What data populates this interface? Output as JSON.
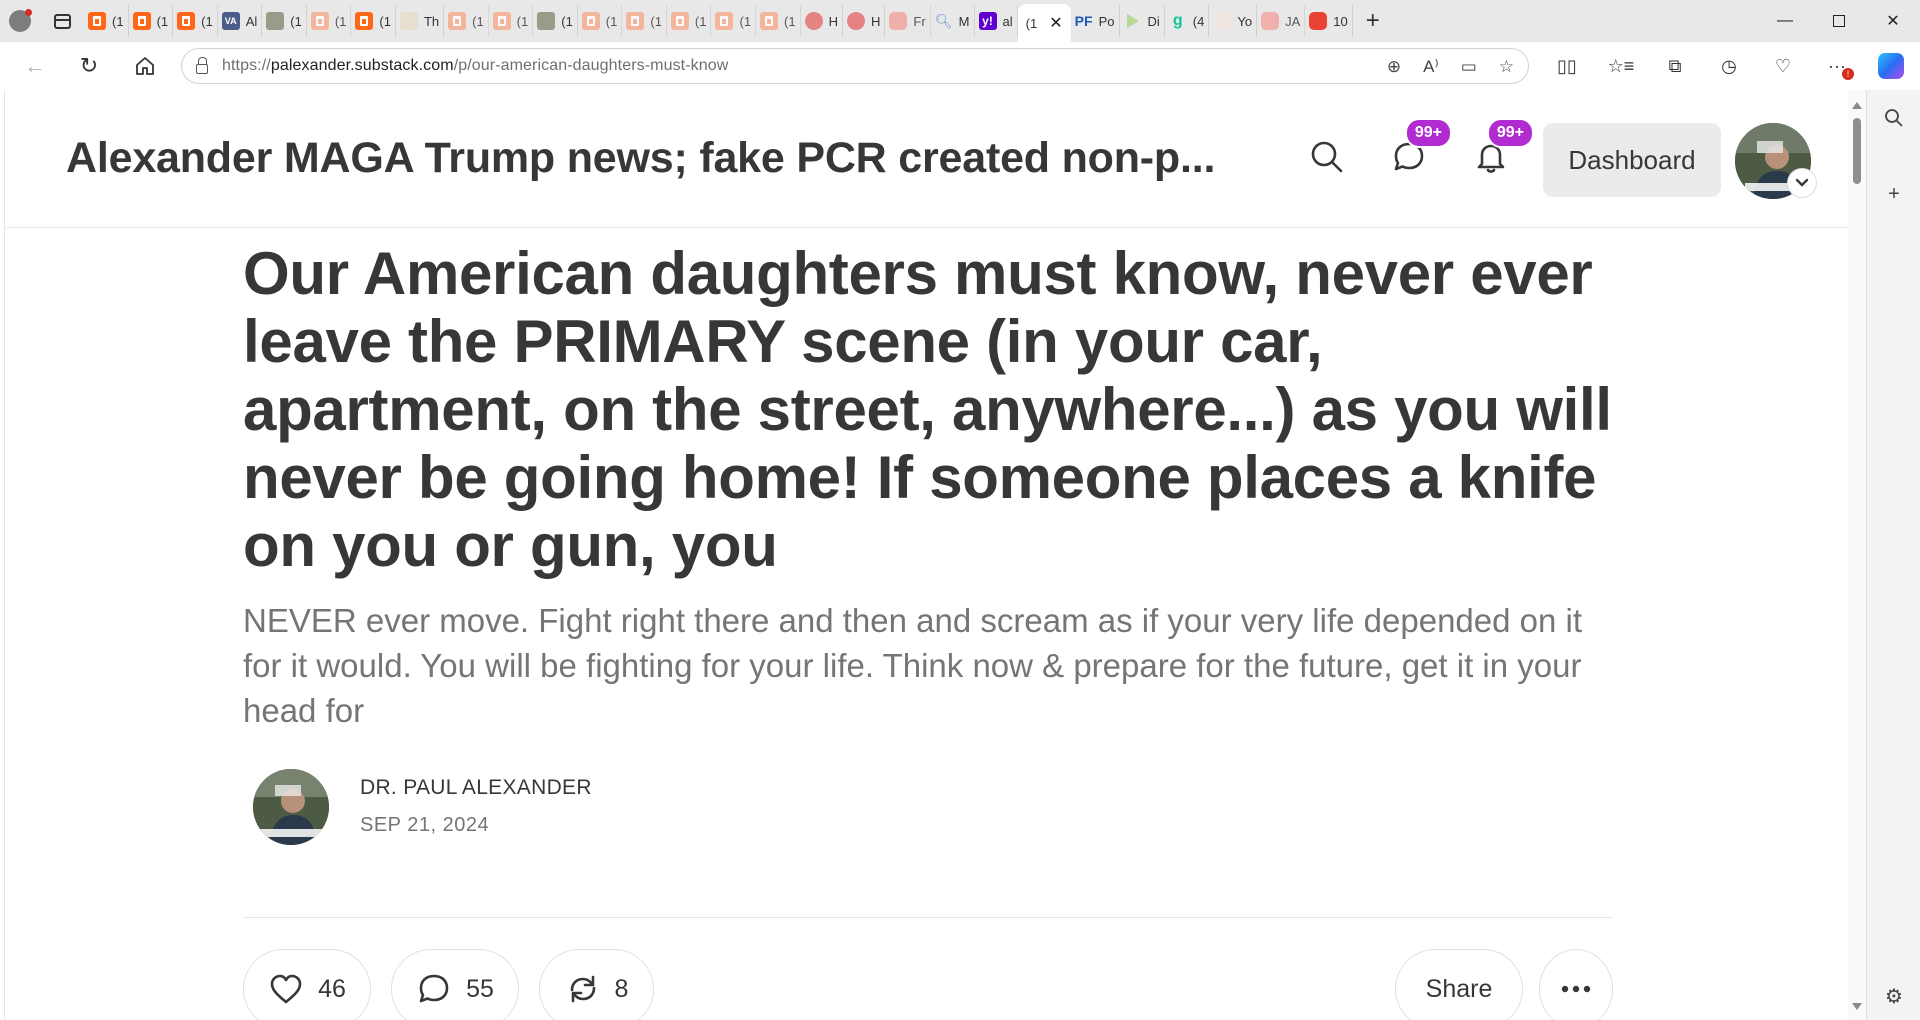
{
  "browser": {
    "tabs": [
      {
        "icon": "substack-icon",
        "label": "(1",
        "style": "ss"
      },
      {
        "icon": "substack-icon",
        "label": "(1",
        "style": "ss"
      },
      {
        "icon": "substack-icon",
        "label": "(1",
        "style": "ss"
      },
      {
        "icon": "va-icon",
        "label": "Al",
        "style": "va"
      },
      {
        "icon": "photo-icon",
        "label": "(1",
        "style": "photo"
      },
      {
        "icon": "substack-icon",
        "label": "(1",
        "style": "ss faded"
      },
      {
        "icon": "substack-icon",
        "label": "(1",
        "style": "ss"
      },
      {
        "icon": "document-icon",
        "label": "Th",
        "style": "doc"
      },
      {
        "icon": "substack-icon",
        "label": "(1",
        "style": "ss faded"
      },
      {
        "icon": "substack-icon",
        "label": "(1",
        "style": "ss faded"
      },
      {
        "icon": "photo-icon",
        "label": "(1",
        "style": "photo"
      },
      {
        "icon": "substack-icon",
        "label": "(1",
        "style": "ss faded"
      },
      {
        "icon": "substack-icon",
        "label": "(1",
        "style": "ss faded"
      },
      {
        "icon": "substack-icon",
        "label": "(1",
        "style": "ss faded"
      },
      {
        "icon": "substack-icon",
        "label": "(1",
        "style": "ss faded"
      },
      {
        "icon": "substack-icon",
        "label": "(1",
        "style": "ss faded"
      },
      {
        "icon": "podcast-icon",
        "label": "H",
        "style": "pod"
      },
      {
        "icon": "podcast-icon",
        "label": "H",
        "style": "pod"
      },
      {
        "icon": "youtube-icon",
        "label": "Fr",
        "style": "yt faded"
      },
      {
        "icon": "magnifier-icon",
        "label": "M",
        "style": "mag"
      },
      {
        "icon": "yahoo-icon",
        "label": "al",
        "style": "yh"
      },
      {
        "icon": "pf-icon",
        "label": "Po",
        "style": "pf"
      },
      {
        "icon": "rumble-icon",
        "label": "Di",
        "style": "rum"
      },
      {
        "icon": "gettr-icon",
        "label": "(4",
        "style": "gt"
      },
      {
        "icon": "bird-icon",
        "label": "Yo",
        "style": "bird"
      },
      {
        "icon": "youtube-icon",
        "label": "JA",
        "style": "yt faded"
      },
      {
        "icon": "youtube-icon",
        "label": "10",
        "style": "yt"
      }
    ],
    "active_tab": {
      "label": "(1"
    },
    "url_prefix": "https://",
    "url_host": "palexander.substack.com",
    "url_path": "/p/our-american-daughters-must-know"
  },
  "site": {
    "publication_title": "Alexander MAGA Trump news; fake PCR created non-p...",
    "messages_badge": "99+",
    "notifications_badge": "99+",
    "dashboard_label": "Dashboard"
  },
  "post": {
    "title": "Our American daughters must know, never ever leave the PRIMARY scene (in your car, apartment, on the street, anywhere...) as you will never be going home! If someone places a knife on you or gun, you",
    "subtitle": "NEVER ever move. Fight right there and then and scream as if your very life depended on it for it would. You will be fighting for your life. Think now & prepare for the future, get it in your head for",
    "author": "DR. PAUL ALEXANDER",
    "date": "SEP 21, 2024",
    "likes": "46",
    "comments": "55",
    "restacks": "8",
    "share_label": "Share"
  }
}
